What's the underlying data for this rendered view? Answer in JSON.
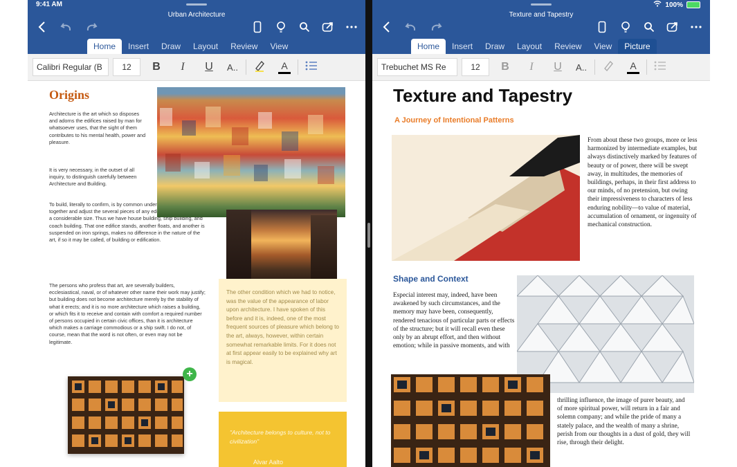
{
  "status": {
    "time": "9:41 AM",
    "battery": "100%"
  },
  "left": {
    "doc_title": "Urban Architecture",
    "tabs": [
      "Home",
      "Insert",
      "Draw",
      "Layout",
      "Review",
      "View"
    ],
    "active_tab": "Home",
    "font": "Calibri Regular (B",
    "size": "12",
    "heading": "Origins",
    "p1": "Architecture is the art which so disposes and adorns the edifices raised by man for whatsoever uses, that the sight of them contributes to his mental health, power and pleasure.",
    "p2": "It is very necessary, in the outset of all inquiry, to distinguish carefully between Architecture and Building.",
    "p3": "To build, literally to confirm, is by common understanding to put together and adjust the several pieces of any edifice or receptacle of a considerable size. Thus we have house building, ship building, and coach building. That one edifice stands, another floats, and another is suspended on iron springs, makes no difference in the nature of the art, if so it may be called, of building or edification.",
    "p4": "The persons who profess that art, are severally builders, ecclesiastical, naval, or of whatever other name their work may justify; but building does not become architecture merely by the stability of what it erects; and it is no more architecture which raises a building, or which fits it to receive and contain with comfort a required number of persons occupied in certain civic offices, than it is architecture which makes a carriage commodious or a ship swift. I do not, of course, mean that the word is not often, or even may not be legitimate.",
    "sidebar": "The other condition which we had to notice, was the value of the appearance of labor upon architecture. I have spoken of this before and it is, indeed, one of the most frequent sources of pleasure which belong to the art, always, however, within certain somewhat remarkable limits. For it does not at first appear easily to be explained why art is magical.",
    "quote": "\"Architecture belongs to culture, not to civilization\"",
    "quote_author": "Alvar Aalto"
  },
  "right": {
    "doc_title": "Texture and Tapestry",
    "tabs": [
      "Home",
      "Insert",
      "Draw",
      "Layout",
      "Review",
      "View",
      "Picture"
    ],
    "active_tab": "Home",
    "selected_tab": "Picture",
    "font": "Trebuchet MS Re",
    "size": "12",
    "title": "Texture and Tapestry",
    "subtitle": "A Journey of Intentional Patterns",
    "p1": "From about these two groups, more or less harmonized by intermediate examples, but always distinctively marked by features of beauty or of power, there will be swept away, in multitudes, the memories of buildings, perhaps, in their first address to our minds, of no pretension, but owing their impressiveness to characters of less enduring nobility—to value of material, accumulation of ornament, or ingenuity of mechanical construction.",
    "section": "Shape and Context",
    "p2": "Especial interest may, indeed, have been awakened by such circumstances, and the memory may have been, consequently, rendered tenacious of particular parts or effects of the structure; but it will recall even these only by an abrupt effort, and then without emotion; while in passive moments, and with",
    "p3": "thrilling influence, the image of purer beauty, and of more spiritual power, will return in a fair and solemn company; and while the pride of many a stately palace, and the wealth of many a shrine, perish from our thoughts in a dust of gold, they will rise, through their delight."
  },
  "colors": {
    "brand": "#2b579a",
    "accent_orange": "#c55a11",
    "sidebar": "#fff2cc",
    "quote": "#f4c431",
    "add": "#3fb64a"
  }
}
